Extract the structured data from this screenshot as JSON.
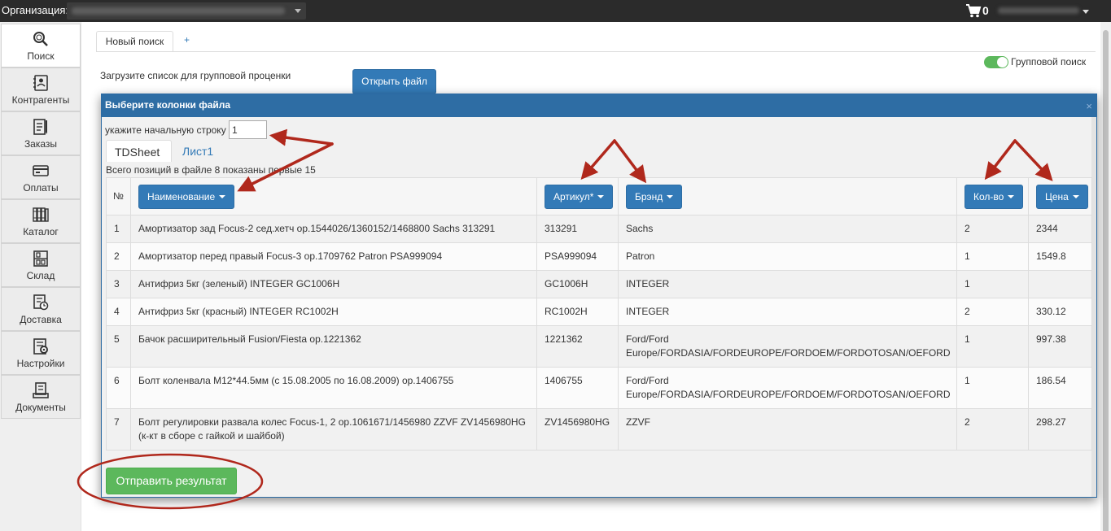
{
  "topbar": {
    "org_label": "Организация:",
    "cart_count": "0",
    "cart_icon": "shopping-cart-icon"
  },
  "sidebar": {
    "items": [
      {
        "label": "Поиск",
        "icon": "search-icon",
        "active": true
      },
      {
        "label": "Контрагенты",
        "icon": "contacts-icon"
      },
      {
        "label": "Заказы",
        "icon": "orders-icon"
      },
      {
        "label": "Оплаты",
        "icon": "payments-icon"
      },
      {
        "label": "Каталог",
        "icon": "catalog-icon"
      },
      {
        "label": "Склад",
        "icon": "warehouse-icon"
      },
      {
        "label": "Доставка",
        "icon": "delivery-icon"
      },
      {
        "label": "Настройки",
        "icon": "settings-icon"
      },
      {
        "label": "Документы",
        "icon": "documents-icon"
      }
    ]
  },
  "tabs": {
    "active": "Новый поиск",
    "add": "+"
  },
  "search": {
    "group_search_label": "Групповой поиск",
    "group_search_on": true,
    "upload_label": "Загрузите список для групповой проценки",
    "open_file_button": "Открыть файл"
  },
  "modal": {
    "title": "Выберите колонки файла",
    "close": "×",
    "start_row_label": "укажите начальную строку",
    "start_row_value": "1",
    "sheets": [
      "TDSheet",
      "Лист1"
    ],
    "active_sheet": "TDSheet",
    "positions_text": "Всего позиций в файле 8 показаны первые 15",
    "columns": {
      "num": "№",
      "name": "Наименование",
      "article": "Артикул*",
      "brand": "Брэнд",
      "qty": "Кол-во",
      "price": "Цена"
    },
    "rows": [
      {
        "num": "1",
        "name": "Амортизатор зад Focus-2 сед.хетч ор.1544026/1360152/1468800 Sachs 313291",
        "article": "313291",
        "brand": "Sachs",
        "qty": "2",
        "price": "2344"
      },
      {
        "num": "2",
        "name": "Амортизатор перед правый Focus-3 ор.1709762 Patron PSA999094",
        "article": "PSA999094",
        "brand": "Patron",
        "qty": "1",
        "price": "1549.8"
      },
      {
        "num": "3",
        "name": "Антифриз 5кг (зеленый) INTEGER GC1006H",
        "article": "GC1006H",
        "brand": "INTEGER",
        "qty": "1",
        "price": ""
      },
      {
        "num": "4",
        "name": "Антифриз 5кг (красный) INTEGER RC1002H",
        "article": "RC1002H",
        "brand": "INTEGER",
        "qty": "2",
        "price": "330.12"
      },
      {
        "num": "5",
        "name": "Бачок расширительный Fusion/Fiesta ор.1221362",
        "article": "1221362",
        "brand": "Ford/Ford Europe/FORDASIA/FORDEUROPE/FORDOEM/FORDOTOSAN/OEFORD",
        "qty": "1",
        "price": "997.38"
      },
      {
        "num": "6",
        "name": "Болт коленвала M12*44.5мм (с 15.08.2005 по 16.08.2009) ор.1406755",
        "article": "1406755",
        "brand": "Ford/Ford Europe/FORDASIA/FORDEUROPE/FORDOEM/FORDOTOSAN/OEFORD",
        "qty": "1",
        "price": "186.54"
      },
      {
        "num": "7",
        "name": "Болт регулировки развала колес Focus-1, 2 ор.1061671/1456980 ZZVF ZV1456980HG (к-кт в сборе с гайкой и шайбой)",
        "article": "ZV1456980HG",
        "brand": "ZZVF",
        "qty": "2",
        "price": "298.27"
      }
    ],
    "submit_button": "Отправить результат"
  },
  "colors": {
    "primary": "#337ab7",
    "success": "#5cb85c",
    "modal_header": "#2e6da4",
    "topbar": "#2b2b2b",
    "annotation": "#b0281c"
  }
}
